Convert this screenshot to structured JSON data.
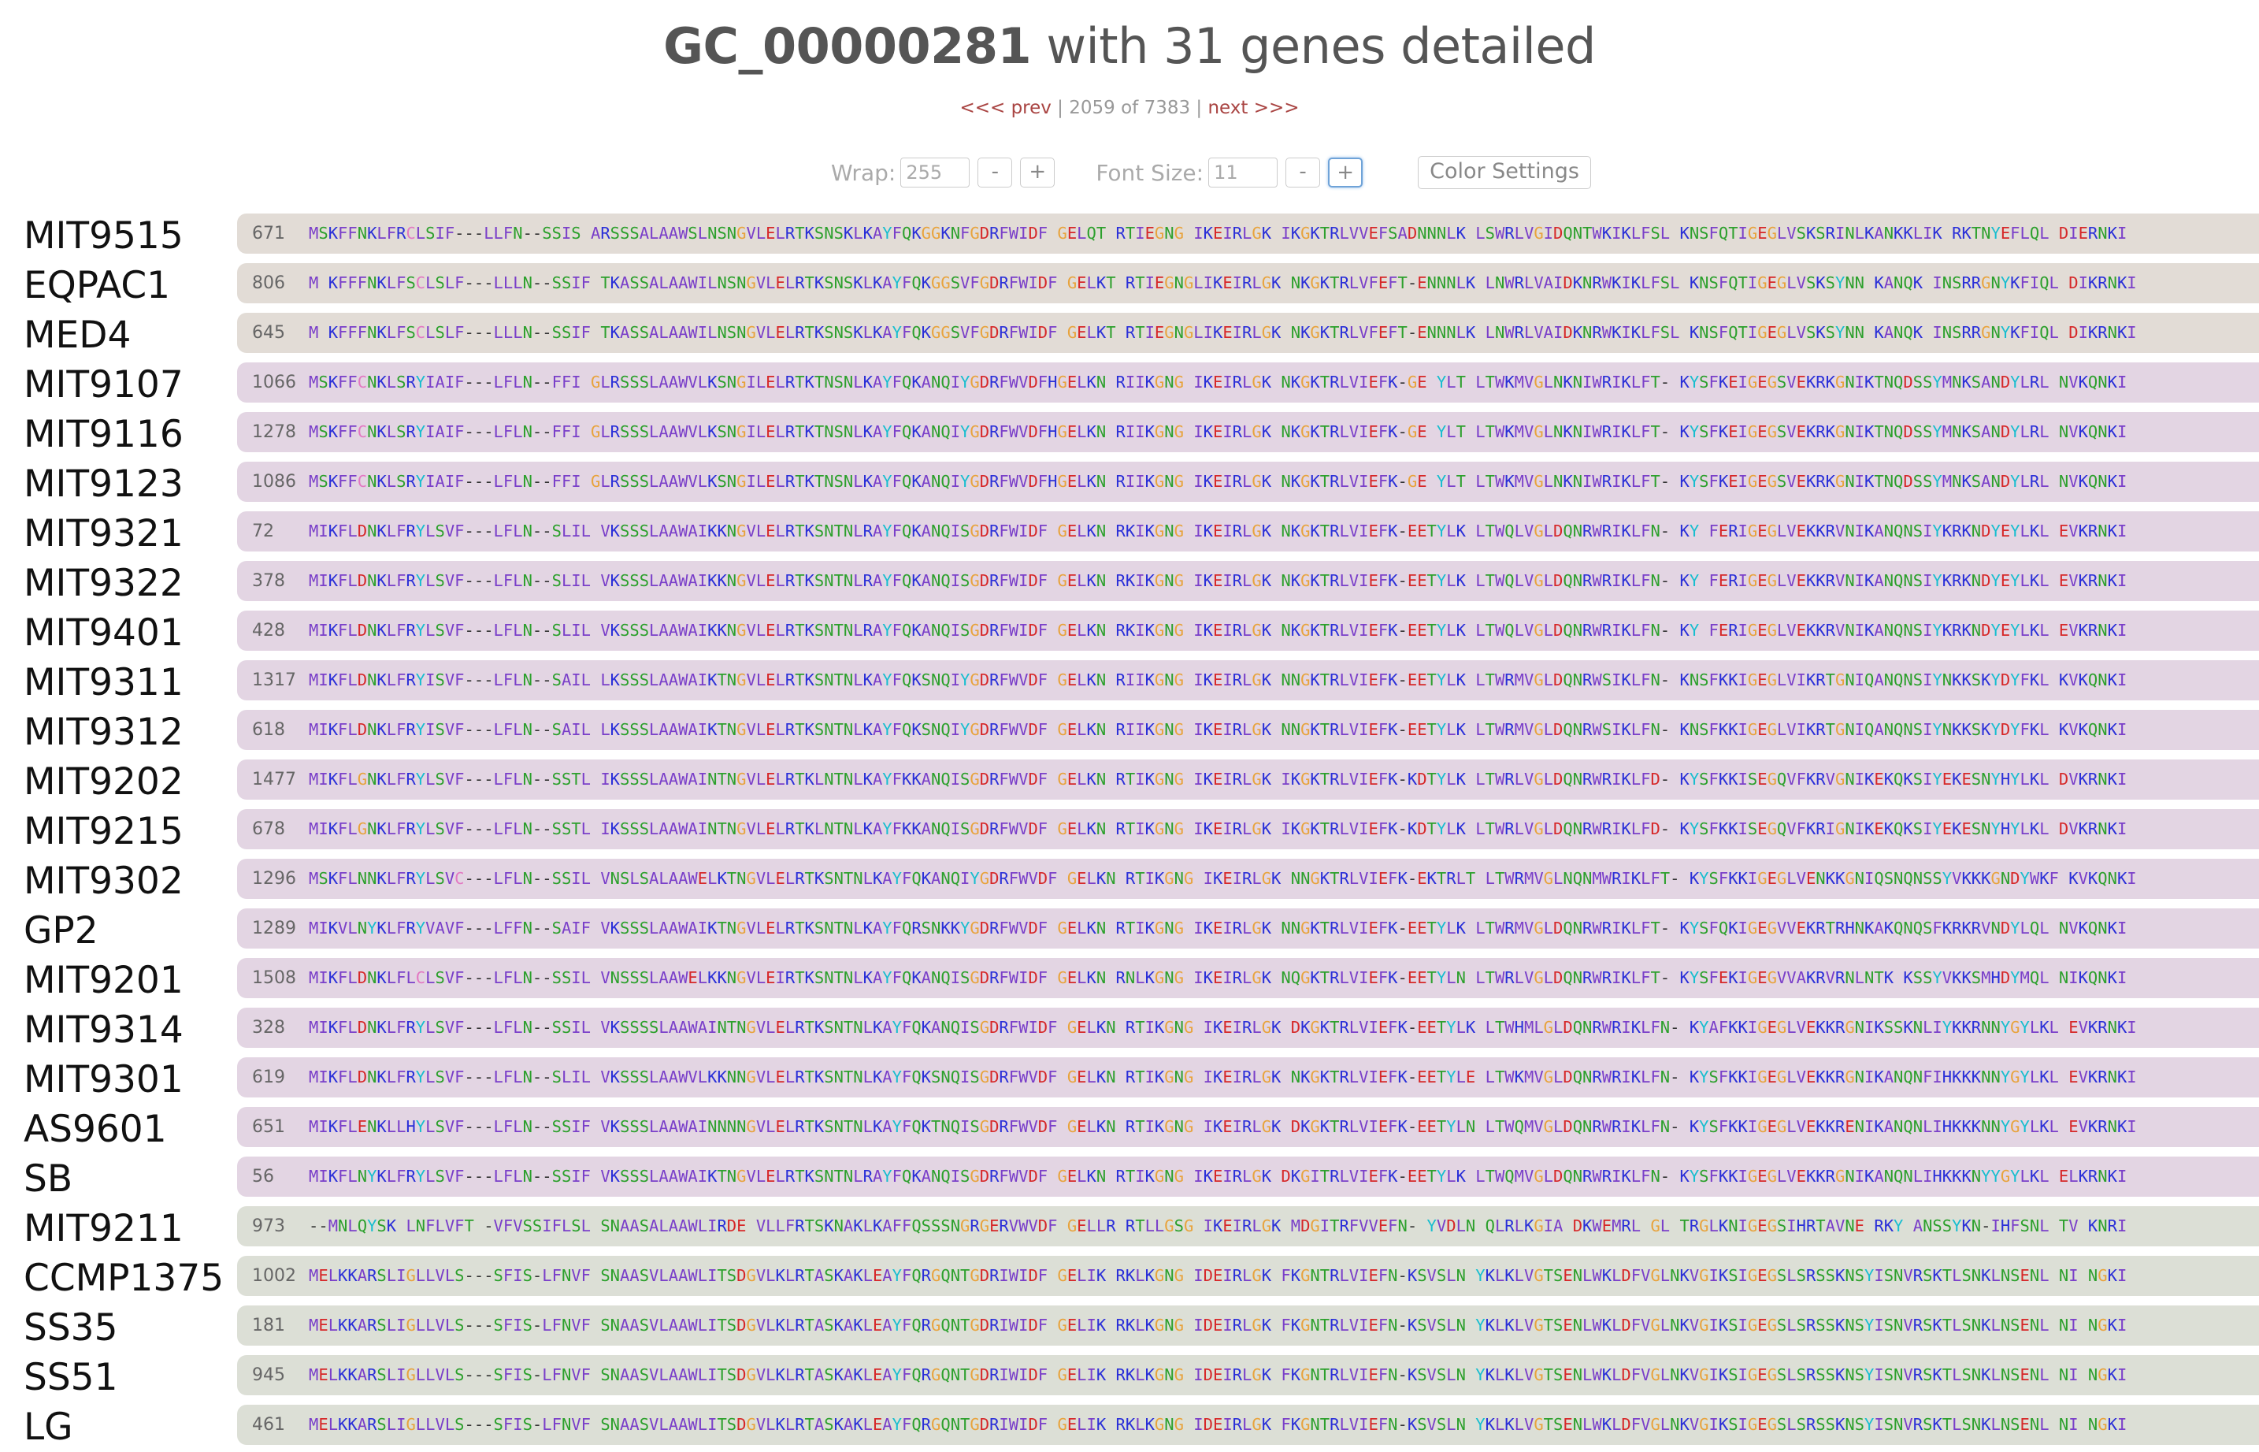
{
  "header": {
    "id": "GC_00000281",
    "subtitle": "with 31 genes detailed"
  },
  "pager": {
    "prev": "<<< prev",
    "sep1": " | ",
    "position": "2059 of 7383",
    "sep2": " | ",
    "next": "next >>>"
  },
  "controls": {
    "wrap_label": "Wrap:",
    "wrap_value": "255",
    "font_label": "Font Size:",
    "font_value": "11",
    "minus": "-",
    "plus": "+",
    "color_settings": "Color Settings"
  },
  "colors": {
    "bar_tan": "#e2dcd6",
    "bar_purple": "#e3d5e3",
    "bar_gray": "#dcdfd6",
    "link": "#a94442"
  },
  "genes": [
    {
      "name": "MIT9515",
      "start": "671",
      "group": "t",
      "seq": "MSKFFNKLFRCLSIF---LLFN--SSIS ARSSSALAAWSLNSNGVLELRTKSNSKLKAYFQKGGKNFGDRFWIDF GELQT RTIEGNG IKEIRLGK IKGKTRLVVEFSADNNNLK LSWRLVGIDQNTWKIKLFSL KNSFQTIGEGLVSKSRINLKANKKLIK RKTNYEFLQL DIERNKI"
    },
    {
      "name": "EQPAC1",
      "start": "806",
      "group": "t",
      "seq": "M KFFFNKLFSCLSLF---LLLN--SSIF TKASSALAAWILNSNGVLELRTKSNSKLKAYFQKGGSVFGDRFWIDF GELKT RTIEGNGLIKEIRLGK NKGKTRLVFEFT-ENNNLK LNWRLVAIDKNRWKIKLFSL KNSFQTIGEGLVSKSYNN KANQK INSRRGNYKFIQL DIKRNKI"
    },
    {
      "name": "MED4",
      "start": "645",
      "group": "t",
      "seq": "M KFFFNKLFSCLSLF---LLLN--SSIF TKASSALAAWILNSNGVLELRTKSNSKLKAYFQKGGSVFGDRFWIDF GELKT RTIEGNGLIKEIRLGK NKGKTRLVFEFT-ENNNLK LNWRLVAIDKNRWKIKLFSL KNSFQTIGEGLVSKSYNN KANQK INSRRGNYKFIQL DIKRNKI"
    },
    {
      "name": "MIT9107",
      "start": "1066",
      "group": "p",
      "seq": "MSKFFCNKLSRYIAIF---LFLN--FFI GLRSSSLAAWVLKSNGILELRTKTNSNLKAYFQKANQIYGDRFWVDFHGELKN RIIKGNG IKEIRLGK NKGKTRLVIEFK-GE YLT LTWKMVGLNKNIWRIKLFT- KYSFKEIGEGSVEKRKGNIKTNQDSSYMNKSANDYLRL NVKQNKI"
    },
    {
      "name": "MIT9116",
      "start": "1278",
      "group": "p",
      "seq": "MSKFFCNKLSRYIAIF---LFLN--FFI GLRSSSLAAWVLKSNGILELRTKTNSNLKAYFQKANQIYGDRFWVDFHGELKN RIIKGNG IKEIRLGK NKGKTRLVIEFK-GE YLT LTWKMVGLNKNIWRIKLFT- KYSFKEIGEGSVEKRKGNIKTNQDSSYMNKSANDYLRL NVKQNKI"
    },
    {
      "name": "MIT9123",
      "start": "1086",
      "group": "p",
      "seq": "MSKFFCNKLSRYIAIF---LFLN--FFI GLRSSSLAAWVLKSNGILELRTKTNSNLKAYFQKANQIYGDRFWVDFHGELKN RIIKGNG IKEIRLGK NKGKTRLVIEFK-GE YLT LTWKMVGLNKNIWRIKLFT- KYSFKEIGEGSVEKRKGNIKTNQDSSYMNKSANDYLRL NVKQNKI"
    },
    {
      "name": "MIT9321",
      "start": "72",
      "group": "p",
      "seq": "MIKFLDNKLFRYLSVF---LFLN--SLIL VKSSSLAAWAIKKNGVLELRTKSNTNLRAYFQKANQISGDRFWIDF GELKN RKIKGNG IKEIRLGK NKGKTRLVIEFK-EETYLK LTWQLVGLDQNRWRIKLFN- KY FERIGEGLVEKKRVNIKANQNSIYKRKNDYEYLKL EVKRNKI"
    },
    {
      "name": "MIT9322",
      "start": "378",
      "group": "p",
      "seq": "MIKFLDNKLFRYLSVF---LFLN--SLIL VKSSSLAAWAIKKNGVLELRTKSNTNLRAYFQKANQISGDRFWIDF GELKN RKIKGNG IKEIRLGK NKGKTRLVIEFK-EETYLK LTWQLVGLDQNRWRIKLFN- KY FERIGEGLVEKKRVNIKANQNSIYKRKNDYEYLKL EVKRNKI"
    },
    {
      "name": "MIT9401",
      "start": "428",
      "group": "p",
      "seq": "MIKFLDNKLFRYLSVF---LFLN--SLIL VKSSSLAAWAIKKNGVLELRTKSNTNLRAYFQKANQISGDRFWIDF GELKN RKIKGNG IKEIRLGK NKGKTRLVIEFK-EETYLK LTWQLVGLDQNRWRIKLFN- KY FERIGEGLVEKKRVNIKANQNSIYKRKNDYEYLKL EVKRNKI"
    },
    {
      "name": "MIT9311",
      "start": "1317",
      "group": "p",
      "seq": "MIKFLDNKLFRYISVF---LFLN--SAIL LKSSSLAAWAIKTNGVLELRTKSNTNLKAYFQKSNQIYGDRFWVDF GELKN RIIKGNG IKEIRLGK NNGKTRLVIEFK-EETYLK LTWRMVGLDQNRWSIKLFN- KNSFKKIGEGLVIKRTGNIQANQNSIYNKKSKYDYFKL KVKQNKI"
    },
    {
      "name": "MIT9312",
      "start": "618",
      "group": "p",
      "seq": "MIKFLDNKLFRYISVF---LFLN--SAIL LKSSSLAAWAIKTNGVLELRTKSNTNLKAYFQKSNQIYGDRFWVDF GELKN RIIKGNG IKEIRLGK NNGKTRLVIEFK-EETYLK LTWRMVGLDQNRWSIKLFN- KNSFKKIGEGLVIKRTGNIQANQNSIYNKKSKYDYFKL KVKQNKI"
    },
    {
      "name": "MIT9202",
      "start": "1477",
      "group": "p",
      "seq": "MIKFLGNKLFRYLSVF---LFLN--SSTL IKSSSLAAWAINTNGVLELRTKLNTNLKAYFKKANQISGDRFWVDF GELKN RTIKGNG IKEIRLGK IKGKTRLVIEFK-KDTYLK LTWRLVGLDQNRWRIKLFD- KYSFKKISEGQVFKRVGNIKEKQKSIYEKESNYHYLKL DVKRNKI"
    },
    {
      "name": "MIT9215",
      "start": "678",
      "group": "p",
      "seq": "MIKFLGNKLFRYLSVF---LFLN--SSTL IKSSSLAAWAINTNGVLELRTKLNTNLKAYFKKANQISGDRFWVDF GELKN RTIKGNG IKEIRLGK IKGKTRLVIEFK-KDTYLK LTWRLVGLDQNRWRIKLFD- KYSFKKISEGQVFKRIGNIKEKQKSIYEKESNYHYLKL DVKRNKI"
    },
    {
      "name": "MIT9302",
      "start": "1296",
      "group": "p",
      "seq": "MSKFLNNKLFRYLSVC---LFLN--SSIL VNSLSALAAWELKTNGVLELRTKSNTNLKAYFQKANQIYGDRFWVDF GELKN RTIKGNG IKEIRLGK NNGKTRLVIEFK-EKTRLT LTWRMVGLNQNMWRIKLFT- KYSFKKIGEGLVENKKGNIQSNQNSSYVKKKGNDYWKF KVKQNKI"
    },
    {
      "name": "GP2",
      "start": "1289",
      "group": "p",
      "seq": "MIKVLNYKLFRYVAVF---LFFN--SAIF VKSSSLAAWAIKTNGVLELRTKSNTNLKAYFQRSNKKYGDRFWVDF GELKN RTIKGNG IKEIRLGK NNGKTRLVIEFK-EETYLK LTWRMVGLDQNRWRIKLFT- KYSFQKIGEGVVEKRTRHNKAKQNQSFKRKRVNDYLQL NVKQNKI"
    },
    {
      "name": "MIT9201",
      "start": "1508",
      "group": "p",
      "seq": "MIKFLDNKLFLCLSVF---LFLN--SSIL VNSSSLAAWELKKNGVLEIRTKSNTNLKAYFQKANQISGDRFWIDF GELKN RNLKGNG IKEIRLGK NQGKTRLVIEFK-EETYLN LTWRLVGLDQNRWRIKLFT- KYSFEKIGEGVVAKRVRNLNTK KSSYVKKSMHDYMQL NIKQNKI"
    },
    {
      "name": "MIT9314",
      "start": "328",
      "group": "p",
      "seq": "MIKFLDNKLFRYLSVF---LFLN--SSIL VKSSSSLAAWAINTNGVLELRTKSNTNLKAYFQKANQISGDRFWIDF GELKN RTIKGNG IKEIRLGK DKGKTRLVIEFK-EETYLK LTWHMLGLDQNRWRIKLFN- KYAFKKIGEGLVEKKRGNIKSSKNLIYKKRNNYGYLKL EVKRNKI"
    },
    {
      "name": "MIT9301",
      "start": "619",
      "group": "p",
      "seq": "MIKFLDNKLFRYLSVF---LFLN--SLIL VKSSSLAAWVLKKNNGVLELRTKSNTNLKAYFQKSNQISGDRFWVDF GELKN RTIKGNG IKEIRLGK NKGKTRLVIEFK-EETYLE LTWKMVGLDQNRWRIKLFN- KYSFKKIGEGLVEKKRGNIKANQNFIHKKKNNYGYLKL EVKRNKI"
    },
    {
      "name": "AS9601",
      "start": "651",
      "group": "p",
      "seq": "MIKFLENKLLHYLSVF---LFLN--SSIF VKSSSLAAWAINNNNGVLELRTKSNTNLKAYFQKTNQISGDRFWVDF GELKN RTIKGNG IKEIRLGK DKGKTRLVIEFK-EETYLN LTWQMVGLDQNRWRIKLFN- KYSFKKIGEGLVEKKRENIKANQNLIHKKKNNYGYLKL EVKRNKI"
    },
    {
      "name": "SB",
      "start": "56",
      "group": "p",
      "seq": "MIKFLNYKLFRYLSVF---LFLN--SSIF VKSSSLAAWAIKTNGVLELRTKSNTNLRAYFQKANQISGDRFWVDF GELKN RTIKGNG IKEIRLGK DKGITRLVIEFK-EETYLK LTWQMVGLDQNRWRIKLFN- KYSFKKIGEGLVEKKRGNIKANQNLIHKKKNYYGYLKL ELKRNKI"
    },
    {
      "name": "MIT9211",
      "start": "973",
      "group": "g",
      "seq": "--MNLQYSK LNFLVFT -VFVSSIFLSL SNAASALAAWLIRDE VLLFRTSKNAKLKAFFQSSSNGRGERVWVDF GELLR RTLLGSG IKEIRLGK MDGITRFVVEFN- YVDLN QLRLKGIA DKWEMRL GL TRGLKNIGEGSIHRTAVNE RKY ANSSYKN-IHFSNL TV KNRI"
    },
    {
      "name": "CCMP1375",
      "start": "1002",
      "group": "g",
      "seq": "MELKKARSLIGLLVLS---SFIS-LFNVF SNAASVLAAWLITSDGVLKLRTASKAKLEAYFQRGQNTGDRIWIDF GELIK RKLKGNG IDEIRLGK FKGNTRLVIEFN-KSVSLN YKLKLVGTSENLWKLDFVGLNKVGIKSIGEGSLSRSSKNSYISNVRSKTLSNKLNSENL NI NGKI"
    },
    {
      "name": "SS35",
      "start": "181",
      "group": "g",
      "seq": "MELKKARSLIGLLVLS---SFIS-LFNVF SNAASVLAAWLITSDGVLKLRTASKAKLEAYFQRGQNTGDRIWIDF GELIK RKLKGNG IDEIRLGK FKGNTRLVIEFN-KSVSLN YKLKLVGTSENLWKLDFVGLNKVGIKSIGEGSLSRSSKNSYISNVRSKTLSNKLNSENL NI NGKI"
    },
    {
      "name": "SS51",
      "start": "945",
      "group": "g",
      "seq": "MELKKARSLIGLLVLS---SFIS-LFNVF SNAASVLAAWLITSDGVLKLRTASKAKLEAYFQRGQNTGDRIWIDF GELIK RKLKGNG IDEIRLGK FKGNTRLVIEFN-KSVSLN YKLKLVGTSENLWKLDFVGLNKVGIKSIGEGSLSRSSKNSYISNVRSKTLSNKLNSENL NI NGKI"
    },
    {
      "name": "LG",
      "start": "461",
      "group": "g",
      "seq": "MELKKARSLIGLLVLS---SFIS-LFNVF SNAASVLAAWLITSDGVLKLRTASKAKLEAYFQRGQNTGDRIWIDF GELIK RKLKGNG IDEIRLGK FKGNTRLVIEFN-KSVSLN YKLKLVGTSENLWKLDFVGLNKVGIKSIGEGSLSRSSKNSYISNVRSKTLSNKLNSENL NI NGKI"
    }
  ]
}
